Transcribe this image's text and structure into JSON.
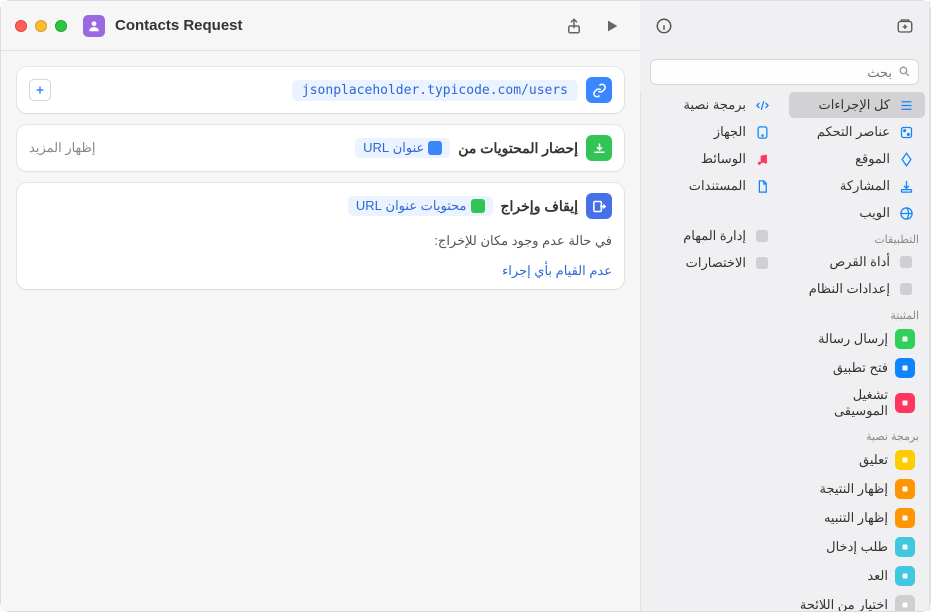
{
  "titlebar": {
    "title": "Contacts Request"
  },
  "search": {
    "placeholder": "بحث"
  },
  "categories_right": [
    {
      "label": "كل الإجراءات",
      "selected": true
    },
    {
      "label": "عناصر التحكم"
    },
    {
      "label": "الموقع"
    },
    {
      "label": "المشاركة"
    },
    {
      "label": "الويب"
    }
  ],
  "categories_left": [
    {
      "label": "برمجة نصية"
    },
    {
      "label": "الجهاز"
    },
    {
      "label": "الوسائط"
    },
    {
      "label": "المستندات"
    }
  ],
  "section_apps": "التطبيقات",
  "apps_right": [
    {
      "label": "أداة القرص"
    },
    {
      "label": "إعدادات النظام"
    }
  ],
  "apps_left": [
    {
      "label": "إدارة المهام"
    },
    {
      "label": "الاختصارات"
    }
  ],
  "section_pinned": "المثبتة",
  "pinned": [
    {
      "label": "إرسال رسالة",
      "color": "pill-green"
    },
    {
      "label": "فتح تطبيق",
      "color": "pill-blue"
    },
    {
      "label": "تشغيل الموسيقى",
      "color": "pill-pink"
    }
  ],
  "section_scripting": "برمجة نصية",
  "scripting": [
    {
      "label": "تعليق",
      "color": "pill-yellow"
    },
    {
      "label": "إظهار النتيجة",
      "color": "pill-orange"
    },
    {
      "label": "إظهار التنبيه",
      "color": "pill-orange"
    },
    {
      "label": "طلب إدخال",
      "color": "pill-teal"
    },
    {
      "label": "العد",
      "color": "pill-teal"
    },
    {
      "label": "اختيار من اللائحة",
      "color": "pill-gray"
    }
  ],
  "actions": {
    "url": {
      "value": "jsonplaceholder.typicode.com/users"
    },
    "fetch": {
      "title": "إحضار المحتويات من",
      "token": "عنوان URL",
      "more": "إظهار المزيد"
    },
    "stop": {
      "title": "إيقاف وإخراج",
      "token": "محتويات عنوان URL",
      "cond_label": "في حالة عدم وجود مكان للإخراج:",
      "cond_value": "عدم القيام بأي إجراء"
    }
  }
}
